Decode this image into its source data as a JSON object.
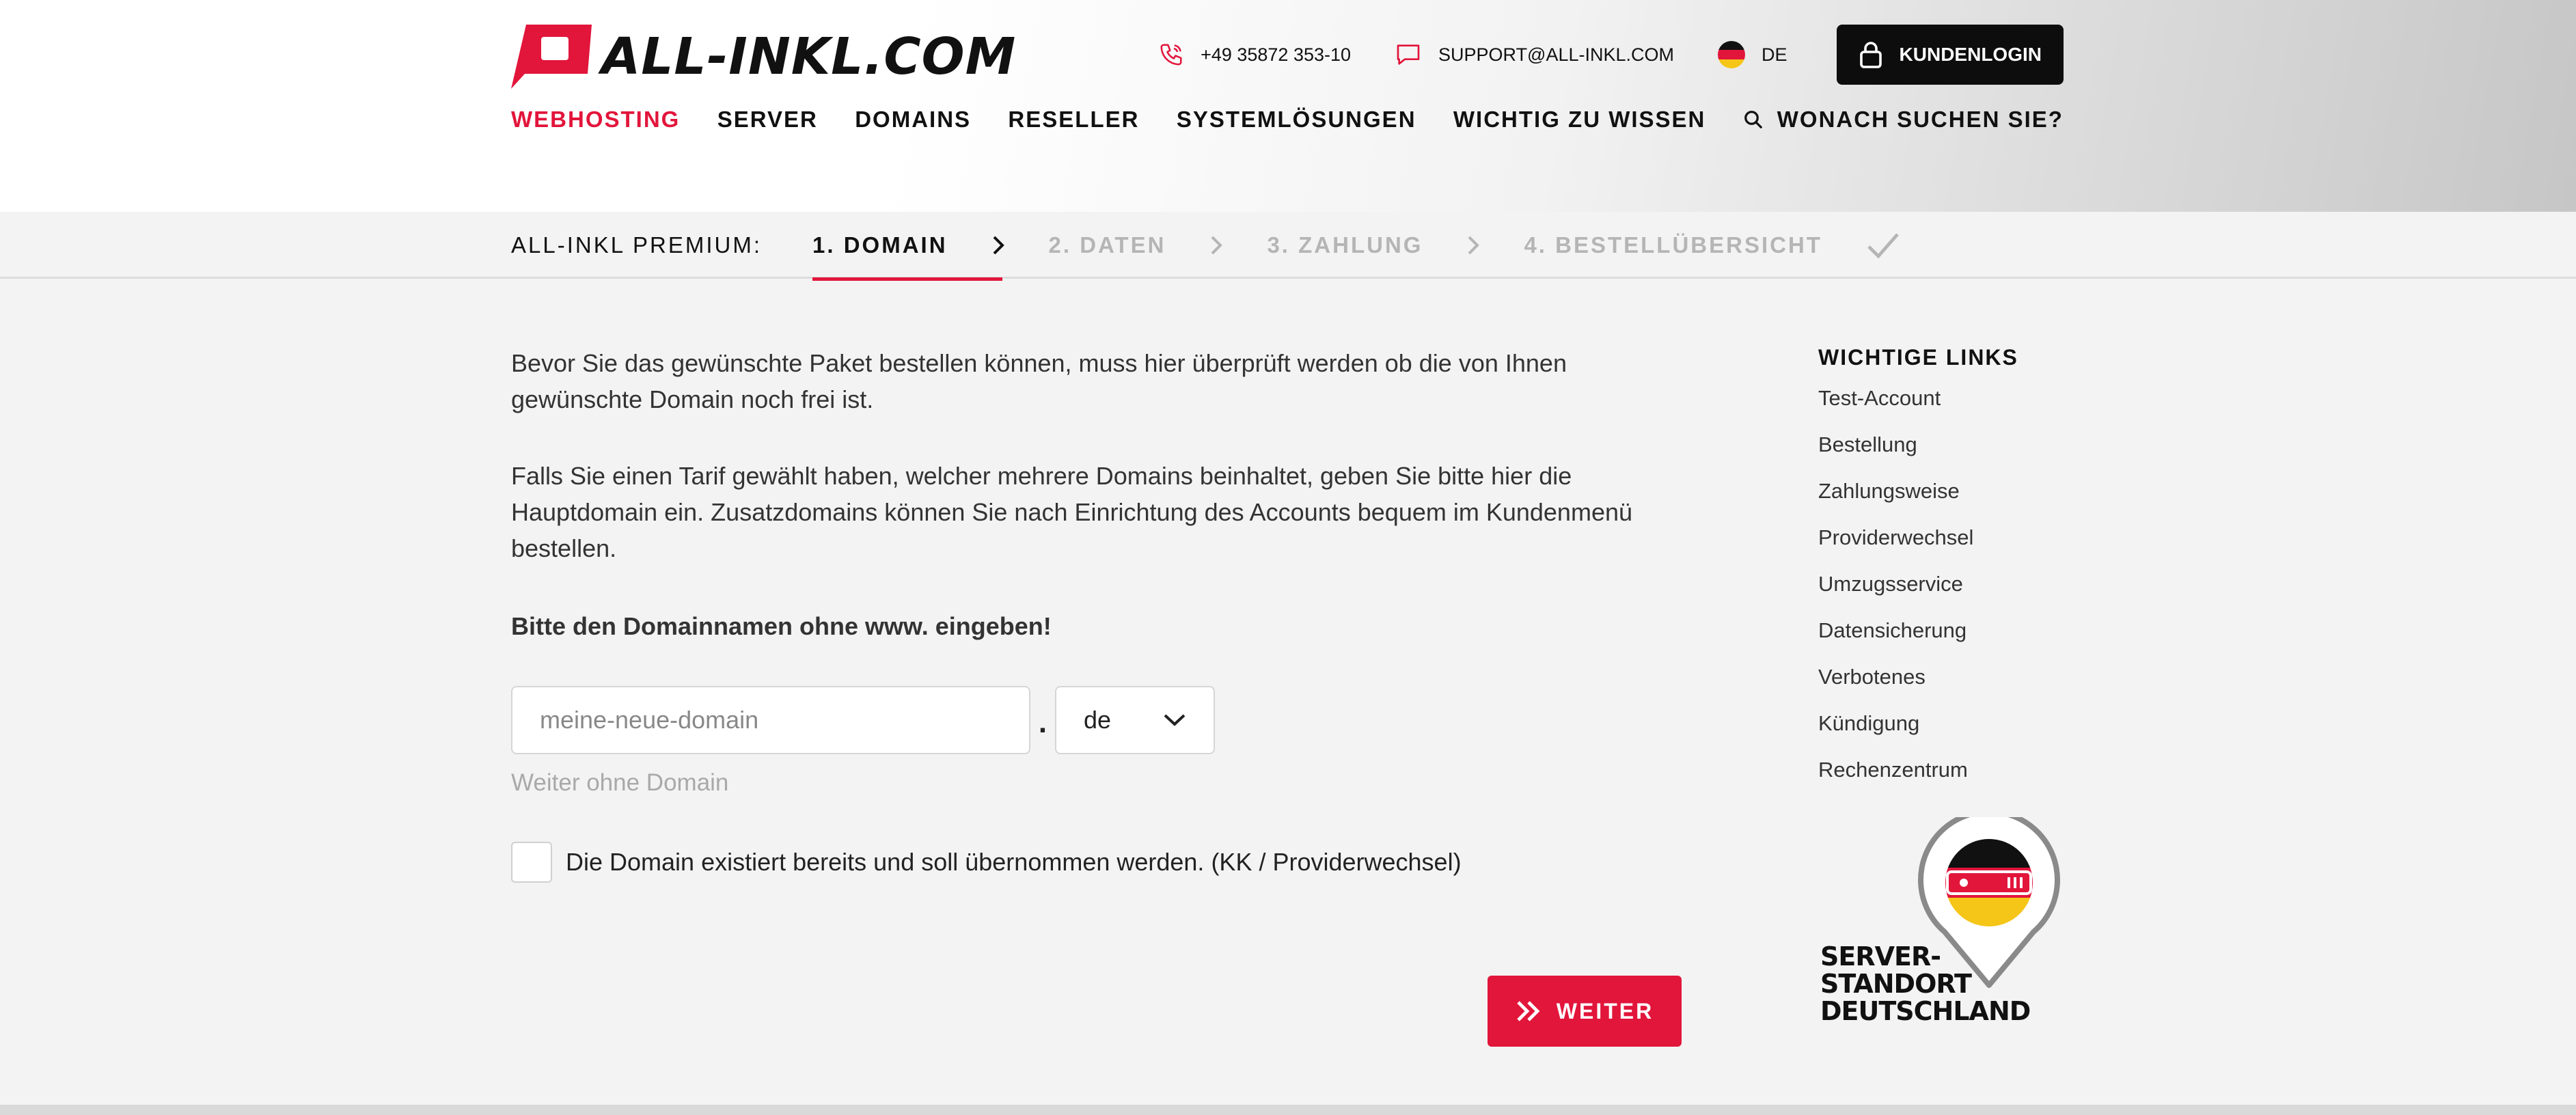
{
  "brand": {
    "name": "ALL-INKL.COM",
    "accent": "#e2153b"
  },
  "header": {
    "phone": "+49 35872 353-10",
    "email": "SUPPORT@ALL-INKL.COM",
    "language": "DE",
    "login_label": "KUNDENLOGIN",
    "nav": {
      "webhosting": "WEBHOSTING",
      "server": "SERVER",
      "domains": "DOMAINS",
      "reseller": "RESELLER",
      "systemloesungen": "SYSTEMLÖSUNGEN",
      "wichtig": "WICHTIG ZU WISSEN",
      "search": "WONACH SUCHEN SIE?"
    }
  },
  "steps": {
    "label": "ALL-INKL PREMIUM:",
    "items": [
      "1. DOMAIN",
      "2. DATEN",
      "3. ZAHLUNG",
      "4. BESTELLÜBERSICHT"
    ],
    "active_index": 0
  },
  "main": {
    "intro": "Bevor Sie das gewünschte Paket bestellen können, muss hier überprüft werden ob die von Ihnen gewünschte Domain noch frei ist.",
    "info": "Falls Sie einen Tarif gewählt haben, welcher mehrere Domains beinhaltet, geben Sie bitte hier die Hauptdomain ein. Zusatzdomains können Sie nach Einrichtung des Accounts bequem im Kundenmenü bestellen.",
    "hint": "Bitte den Domainnamen ohne www. eingeben!",
    "domain_input": {
      "placeholder": "meine-neue-domain",
      "value": ""
    },
    "dot": ".",
    "tld": "de",
    "skip_link": "Weiter ohne Domain",
    "transfer_checkbox": {
      "label": "Die Domain existiert bereits und soll übernommen werden. (KK / Providerwechsel)",
      "checked": false
    },
    "submit_label": "WEITER"
  },
  "sidebar": {
    "title": "WICHTIGE LINKS",
    "links": [
      "Test-Account",
      "Bestellung",
      "Zahlungsweise",
      "Providerwechsel",
      "Umzugsservice",
      "Datensicherung",
      "Verbotenes",
      "Kündigung",
      "Rechenzentrum"
    ],
    "badge": {
      "line1": "SERVER-",
      "line2": "STANDORT",
      "line3": "DEUTSCHLAND"
    }
  }
}
